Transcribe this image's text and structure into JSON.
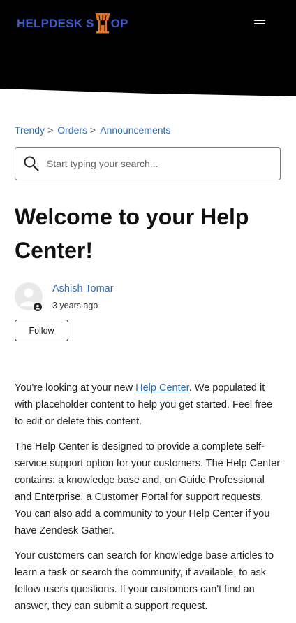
{
  "header": {
    "logo_text_left": "HELPDESK S",
    "logo_text_right": "OP",
    "menu_icon": "hamburger-menu-icon"
  },
  "breadcrumb": [
    {
      "label": "Trendy"
    },
    {
      "label": "Orders"
    },
    {
      "label": "Announcements"
    }
  ],
  "breadcrumb_separator": ">",
  "search": {
    "placeholder": "Start typing your search...",
    "icon": "search-icon"
  },
  "article": {
    "title": "Welcome to your Help Center!",
    "author": {
      "name": "Ashish Tomar",
      "time": "3 years ago"
    },
    "follow_label": "Follow",
    "paragraph1": {
      "before_link": "You're looking at your new ",
      "link": "Help Center",
      "after_link": ". We populated it with placeholder content to help you get started. Feel free to edit or delete this content."
    },
    "paragraph2": "The Help Center is designed to provide a complete self-service support option for your customers. The Help Center contains: a knowledge base and, on Guide Professional and Enterprise, a Customer Portal for support requests. You can also add a community to your Help Center if you have Zendesk Gather.",
    "paragraph3": "Your customers can search for knowledge base articles to learn a task or search the community, if available, to ask fellow users questions. If your customers can't find an answer, they can submit a support request."
  },
  "colors": {
    "header_bg": "#000000",
    "logo_blue": "#3b5bcc",
    "logo_orange": "#e8731e",
    "link": "#2d6ab5"
  }
}
